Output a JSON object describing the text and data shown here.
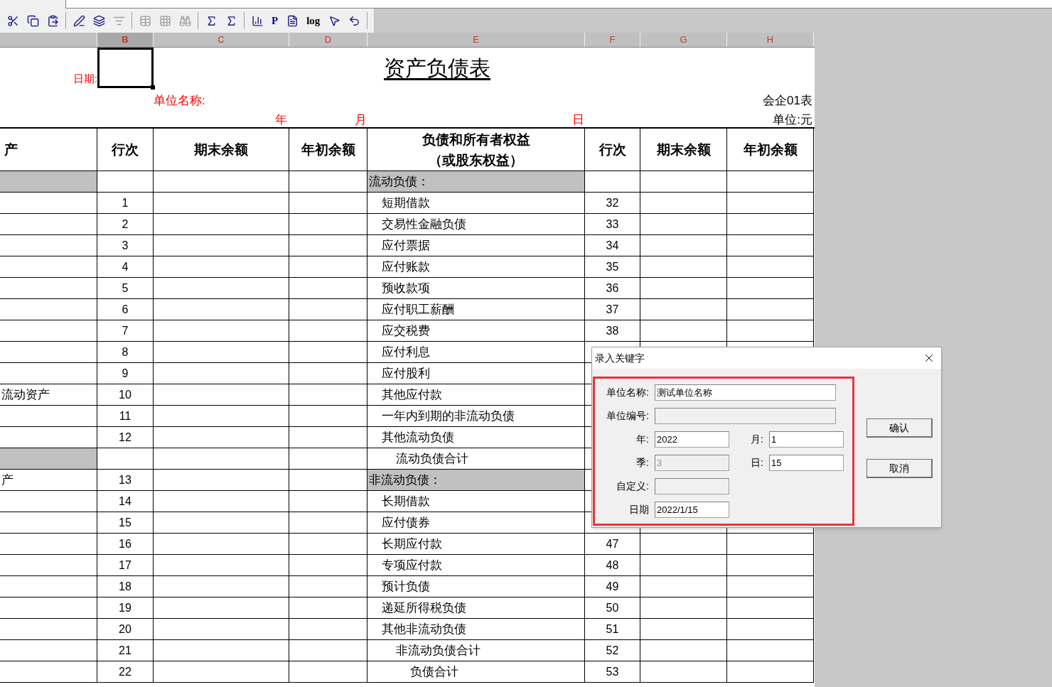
{
  "toolbar": {
    "buttons": [
      {
        "kind": "icon",
        "disabled": false
      },
      {
        "kind": "icon",
        "disabled": false
      },
      {
        "kind": "icon",
        "disabled": false
      },
      {
        "kind": "icon",
        "disabled": false
      },
      {
        "kind": "icon",
        "disabled": false
      },
      {
        "kind": "icon",
        "disabled": true
      },
      {
        "kind": "icon",
        "disabled": true
      },
      {
        "kind": "icon",
        "disabled": true
      },
      {
        "kind": "icon",
        "disabled": true
      },
      {
        "kind": "icon",
        "disabled": false
      },
      {
        "kind": "icon",
        "disabled": false
      },
      {
        "kind": "icon",
        "disabled": false
      },
      {
        "kind": "glyph",
        "glyph": "P",
        "disabled": false
      },
      {
        "kind": "icon",
        "disabled": false
      },
      {
        "kind": "glyph",
        "glyph": "log",
        "disabled": false
      },
      {
        "kind": "icon",
        "disabled": false
      },
      {
        "kind": "icon",
        "disabled": false
      }
    ]
  },
  "column_headers": [
    {
      "label": "B",
      "selected": true
    },
    {
      "label": "C",
      "selected": false
    },
    {
      "label": "D",
      "selected": false
    },
    {
      "label": "E",
      "selected": false
    },
    {
      "label": "F",
      "selected": false
    },
    {
      "label": "G",
      "selected": false
    },
    {
      "label": "H",
      "selected": false
    }
  ],
  "sheet": {
    "date_label": "日期:",
    "title": "资产负债表",
    "unit_name_label": "单位名称:",
    "form_code": "会企01表",
    "year_label": "年",
    "month_label": "月",
    "day_label": "日",
    "currency_unit": "单位:元",
    "header": [
      "产",
      "行次",
      "期末余额",
      "年初余额",
      "负债和所有者权益（或股东权益）",
      "行次",
      "期末余额",
      "年初余额"
    ],
    "rows": [
      {
        "a": "",
        "b": "",
        "e": "流动负债：",
        "f": "",
        "shade_a": true,
        "shade_e": true,
        "kind": "heading"
      },
      {
        "a": "",
        "b": "1",
        "e": "短期借款",
        "f": "32",
        "shade_a": false,
        "shade_e": false,
        "kind": "item"
      },
      {
        "a": "",
        "b": "2",
        "e": "交易性金融负债",
        "f": "33",
        "shade_a": false,
        "shade_e": false,
        "kind": "item"
      },
      {
        "a": "",
        "b": "3",
        "e": "应付票据",
        "f": "34",
        "shade_a": false,
        "shade_e": false,
        "kind": "item"
      },
      {
        "a": "",
        "b": "4",
        "e": "应付账款",
        "f": "35",
        "shade_a": false,
        "shade_e": false,
        "kind": "item"
      },
      {
        "a": "",
        "b": "5",
        "e": "预收款项",
        "f": "36",
        "shade_a": false,
        "shade_e": false,
        "kind": "item"
      },
      {
        "a": "",
        "b": "6",
        "e": "应付职工薪酬",
        "f": "37",
        "shade_a": false,
        "shade_e": false,
        "kind": "item"
      },
      {
        "a": "",
        "b": "7",
        "e": "应交税费",
        "f": "38",
        "shade_a": false,
        "shade_e": false,
        "kind": "item"
      },
      {
        "a": "",
        "b": "8",
        "e": "应付利息",
        "f": "",
        "shade_a": false,
        "shade_e": false,
        "kind": "item"
      },
      {
        "a": "",
        "b": "9",
        "e": "应付股利",
        "f": "",
        "shade_a": false,
        "shade_e": false,
        "kind": "item"
      },
      {
        "a": "流动资产",
        "b": "10",
        "e": "其他应付款",
        "f": "",
        "shade_a": false,
        "shade_e": false,
        "kind": "item"
      },
      {
        "a": "",
        "b": "11",
        "e": "一年内到期的非流动负债",
        "f": "",
        "shade_a": false,
        "shade_e": false,
        "kind": "item"
      },
      {
        "a": "",
        "b": "12",
        "e": "其他流动负债",
        "f": "",
        "shade_a": false,
        "shade_e": false,
        "kind": "item"
      },
      {
        "a": "",
        "b": "",
        "e": "流动负债合计",
        "f": "",
        "shade_a": true,
        "shade_e": false,
        "kind": "subtotal"
      },
      {
        "a": "产",
        "b": "13",
        "e": "非流动负债：",
        "f": "",
        "shade_a": false,
        "shade_e": true,
        "kind": "heading"
      },
      {
        "a": "",
        "b": "14",
        "e": "长期借款",
        "f": "",
        "shade_a": false,
        "shade_e": false,
        "kind": "item"
      },
      {
        "a": "",
        "b": "15",
        "e": "应付债券",
        "f": "",
        "shade_a": false,
        "shade_e": false,
        "kind": "item"
      },
      {
        "a": "",
        "b": "16",
        "e": "长期应付款",
        "f": "47",
        "shade_a": false,
        "shade_e": false,
        "kind": "item"
      },
      {
        "a": "",
        "b": "17",
        "e": "专项应付款",
        "f": "48",
        "shade_a": false,
        "shade_e": false,
        "kind": "item"
      },
      {
        "a": "",
        "b": "18",
        "e": "预计负债",
        "f": "49",
        "shade_a": false,
        "shade_e": false,
        "kind": "item"
      },
      {
        "a": "",
        "b": "19",
        "e": "递延所得税负债",
        "f": "50",
        "shade_a": false,
        "shade_e": false,
        "kind": "item"
      },
      {
        "a": "",
        "b": "20",
        "e": "其他非流动负债",
        "f": "51",
        "shade_a": false,
        "shade_e": false,
        "kind": "item"
      },
      {
        "a": "",
        "b": "21",
        "e": "非流动负债合计",
        "f": "52",
        "shade_a": false,
        "shade_e": false,
        "kind": "subtotal"
      },
      {
        "a": "",
        "b": "22",
        "e": "负债合计",
        "f": "53",
        "shade_a": false,
        "shade_e": false,
        "kind": "total"
      }
    ]
  },
  "dialog": {
    "title": "录入关键字",
    "rows": [
      [
        {
          "label": "单位名称:",
          "value": "测试单位名称",
          "disabled": false,
          "kind": "wide"
        }
      ],
      [
        {
          "label": "单位编号:",
          "disabled": true,
          "kind": "wide"
        }
      ],
      [
        {
          "label": "年:",
          "value": "2022",
          "disabled": false,
          "kind": "short"
        },
        {
          "label": "月:",
          "value": "1",
          "disabled": false,
          "kind": "short"
        }
      ],
      [
        {
          "label": "季:",
          "value": "3",
          "disabled": true,
          "kind": "short"
        },
        {
          "label": "日:",
          "value": "15",
          "disabled": false,
          "kind": "short"
        }
      ],
      [
        {
          "label": "自定义:",
          "disabled": true,
          "kind": "short"
        }
      ],
      [
        {
          "label": "日期",
          "value": "2022/1/15",
          "disabled": false,
          "kind": "short"
        }
      ]
    ],
    "buttons": [
      "确认",
      "取消"
    ]
  }
}
